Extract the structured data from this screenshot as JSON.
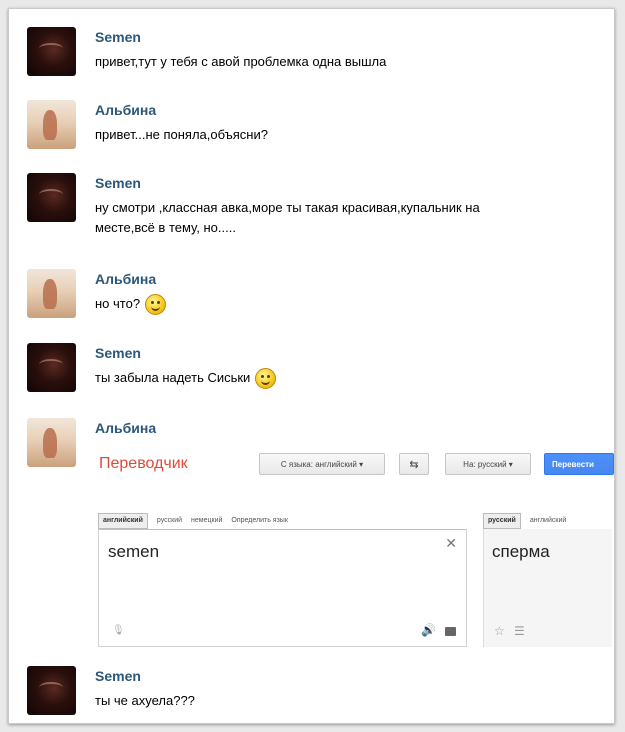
{
  "messages": [
    {
      "author": "Semen",
      "text": "привет,тут у тебя с авой проблемка одна вышла"
    },
    {
      "author": "Альбина",
      "text": "привет...не поняла,объясни?"
    },
    {
      "author": "Semen",
      "line1": "ну смотри ,классная авка,море ты такая красивая,купальник на",
      "line2": "месте,всё в тему, но....."
    },
    {
      "author": "Альбина",
      "text": "но что?"
    },
    {
      "author": "Semen",
      "text": "ты забыла надеть Сиськи"
    },
    {
      "author": "Альбина"
    },
    {
      "author": "Semen",
      "text": "ты че ахуела???"
    }
  ],
  "translator": {
    "title": "Переводчик",
    "from_label": "С языка: английский",
    "to_label": "На: русский",
    "translate_button": "Перевести",
    "source_langs": [
      "английский",
      "русский",
      "немецкий",
      "Определить язык"
    ],
    "target_langs": [
      "русский",
      "английский"
    ],
    "source_text": "semen",
    "result_text": "сперма"
  },
  "icons": {
    "wink_smiley": "winking-face-icon",
    "smile_smiley": "smiling-face-icon"
  }
}
